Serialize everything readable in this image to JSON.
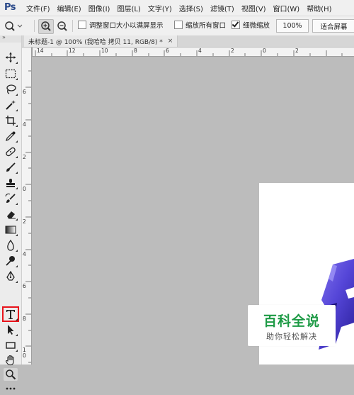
{
  "app": {
    "logo": "Ps"
  },
  "menu": [
    "文件(F)",
    "编辑(E)",
    "图像(I)",
    "图层(L)",
    "文字(Y)",
    "选择(S)",
    "滤镜(T)",
    "视图(V)",
    "窗口(W)",
    "帮助(H)"
  ],
  "options": {
    "fit_window_label": "调整窗口大小以满屏显示",
    "fit_window_checked": false,
    "zoom_all_label": "缩放所有窗口",
    "zoom_all_checked": false,
    "scrubby_label": "细微缩放",
    "scrubby_checked": true,
    "zoom_value": "100%",
    "fit_screen_label": "适合屏幕"
  },
  "document": {
    "tab_title": "未标题-1 @ 100% (我哈哈 拷贝 11, RGB/8) *",
    "close_glyph": "×"
  },
  "rulers": {
    "horizontal": [
      "14",
      "12",
      "10",
      "8",
      "6",
      "4",
      "2",
      "0",
      "2"
    ],
    "vertical": [
      "6",
      "4",
      "2",
      "0",
      "2",
      "4",
      "6",
      "8",
      "1\n0"
    ]
  },
  "watermark": {
    "title": "百科全说",
    "subtitle": "助你轻松解决"
  },
  "toolbar": {
    "collapse_glyph": "»",
    "tools": [
      "move-tool",
      "marquee-tool",
      "lasso-tool",
      "magic-wand-tool",
      "crop-tool",
      "eyedropper-tool",
      "healing-brush-tool",
      "brush-tool",
      "clone-stamp-tool",
      "history-brush-tool",
      "eraser-tool",
      "gradient-tool",
      "blur-tool",
      "dodge-tool",
      "pen-tool",
      "type-tool",
      "path-selection-tool",
      "rectangle-tool",
      "hand-tool",
      "zoom-tool",
      "more-tools"
    ],
    "highlighted_tool": "type-tool",
    "highlight_color": "#e8131b"
  },
  "colors": {
    "accent_ps": "#2b4a8a",
    "canvas_bg": "#bcbcbc",
    "watermark_green": "#1d9a45"
  }
}
